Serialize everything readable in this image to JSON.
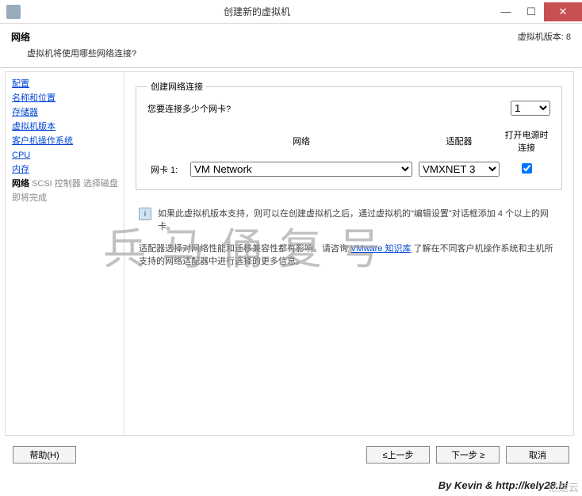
{
  "titlebar": {
    "title": "创建新的虚拟机"
  },
  "winctl": {
    "min": "—",
    "max": "☐",
    "close": "✕"
  },
  "banner": {
    "title": "网络",
    "version": "虚拟机版本: 8",
    "subtitle": "虚拟机将使用哪些网络连接?"
  },
  "steps": {
    "config": "配置",
    "name_loc": "名称和位置",
    "storage": "存储器",
    "vm_version": "虚拟机版本",
    "guest_os": "客户机操作系统",
    "cpu": "CPU",
    "memory": "内存",
    "network": "网络",
    "scsi": "SCSI 控制器",
    "disk": "选择磁盘",
    "finish": "即将完成"
  },
  "group": {
    "legend": "创建网络连接"
  },
  "question": {
    "label": "您要连接多少个网卡?",
    "value": "1"
  },
  "table": {
    "col_network": "网络",
    "col_adapter": "适配器",
    "col_connect": "打开电源时连接",
    "rows": [
      {
        "label": "网卡 1:",
        "network": "VM Network",
        "adapter": "VMXNET 3",
        "connect": true
      }
    ]
  },
  "info": "如果此虚拟机版本支持，则可以在创建虚拟机之后，通过虚拟机的\"编辑设置\"对话框添加 4 个以上的网卡。",
  "help": {
    "pre": "适配器选择对网络性能和迁移兼容性都有影响。请咨询 ",
    "link": "VMware 知识库",
    "post": " 了解在不同客户机操作系统和主机所支持的网络适配器中进行选择的更多信息。"
  },
  "buttons": {
    "help": "帮助(H)",
    "back": "≤上一步",
    "next": "下一步 ≥",
    "cancel": "取消"
  },
  "credits": "By Kevin & http://kely28.bl",
  "logo": "亿速云",
  "watermark": "兵马俑复号"
}
